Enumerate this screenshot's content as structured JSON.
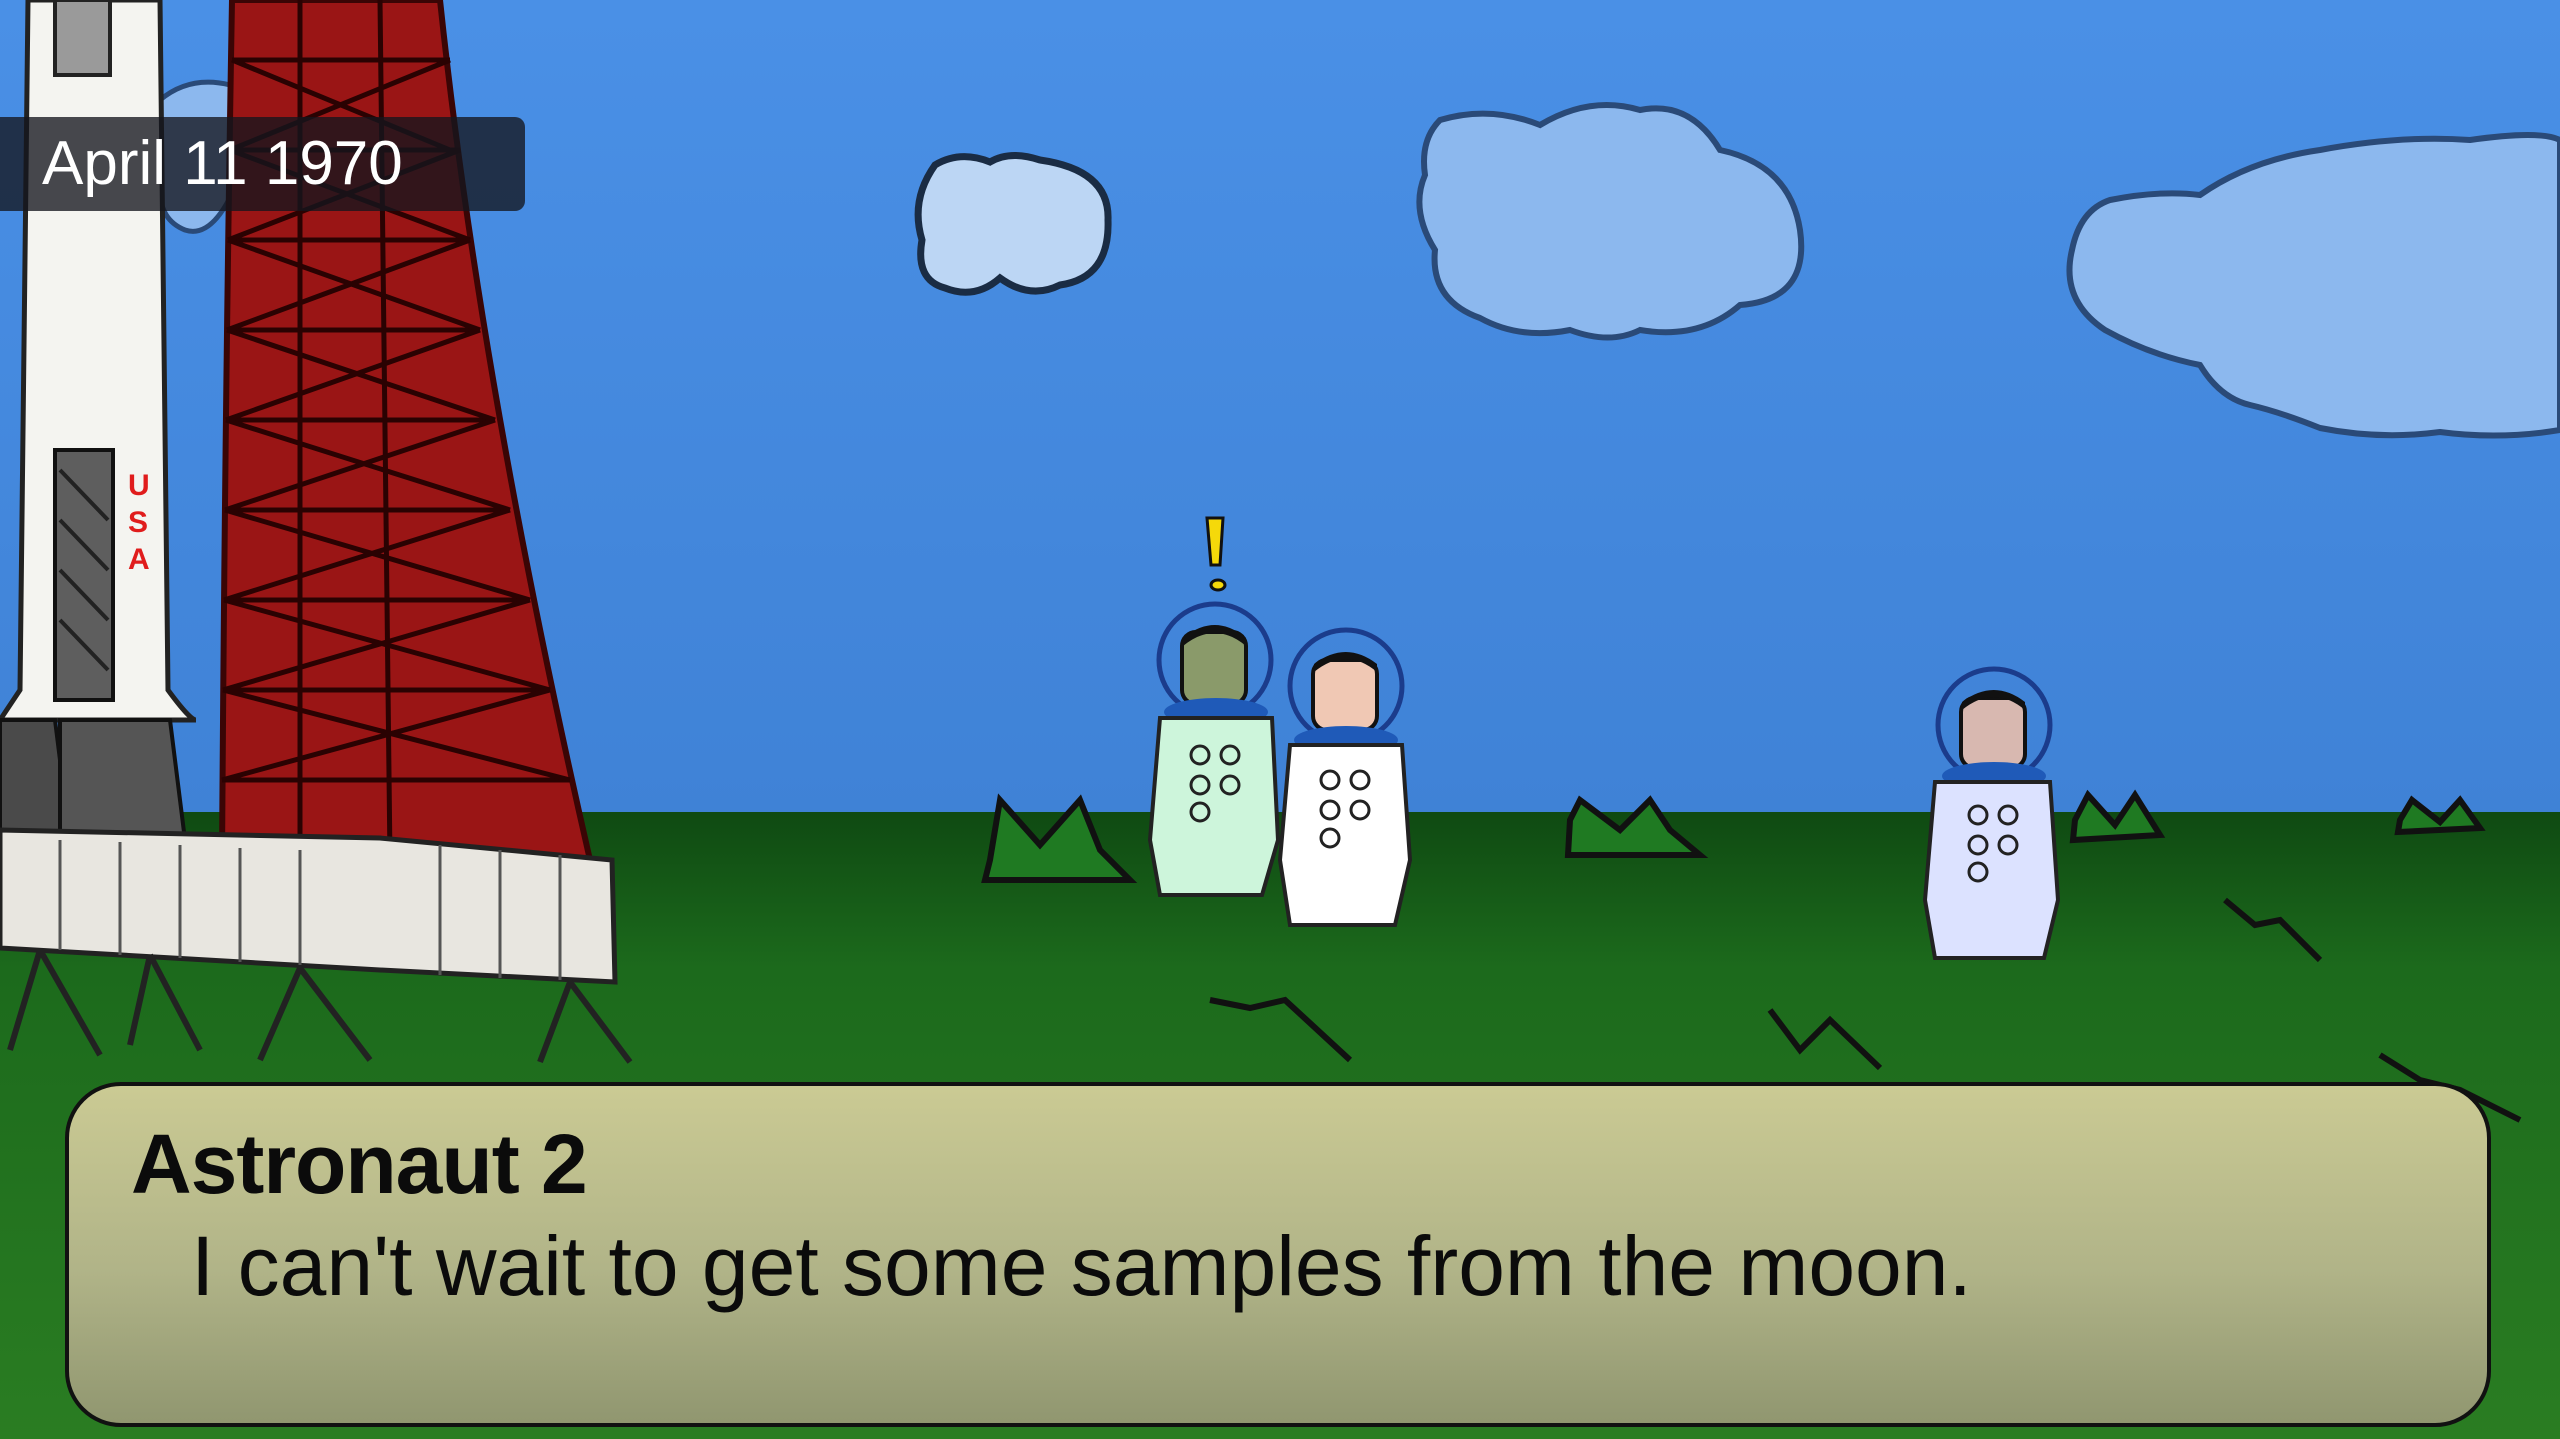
{
  "hud": {
    "date": "April 11 1970"
  },
  "rocket": {
    "markings": [
      "U",
      "S",
      "A"
    ]
  },
  "dialog": {
    "speaker": "Astronaut 2",
    "text": "I can't wait to get some samples from the moon."
  },
  "colors": {
    "sky": "#4a8ee3",
    "grass": "#1f6b1f",
    "tower": "#9c1212",
    "alert": "#f5d90a"
  }
}
